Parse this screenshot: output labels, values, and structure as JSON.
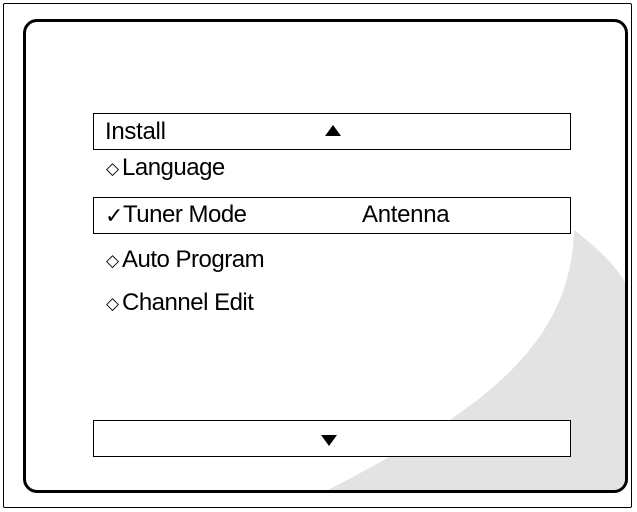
{
  "menu": {
    "title": "Install",
    "scroll_up_icon": "triangle-up-icon",
    "scroll_down_icon": "triangle-down-icon",
    "items": [
      {
        "label": "Language",
        "marker": "◇",
        "selected": false
      },
      {
        "label": "Tuner Mode",
        "marker": "✓",
        "value": "Antenna",
        "selected": true
      },
      {
        "label": "Auto Program",
        "marker": "◇",
        "selected": false
      },
      {
        "label": "Channel Edit",
        "marker": "◇",
        "selected": false
      }
    ]
  },
  "colors": {
    "text": "#000000",
    "background": "#ffffff",
    "screen_shade": "#e3e3e3"
  }
}
